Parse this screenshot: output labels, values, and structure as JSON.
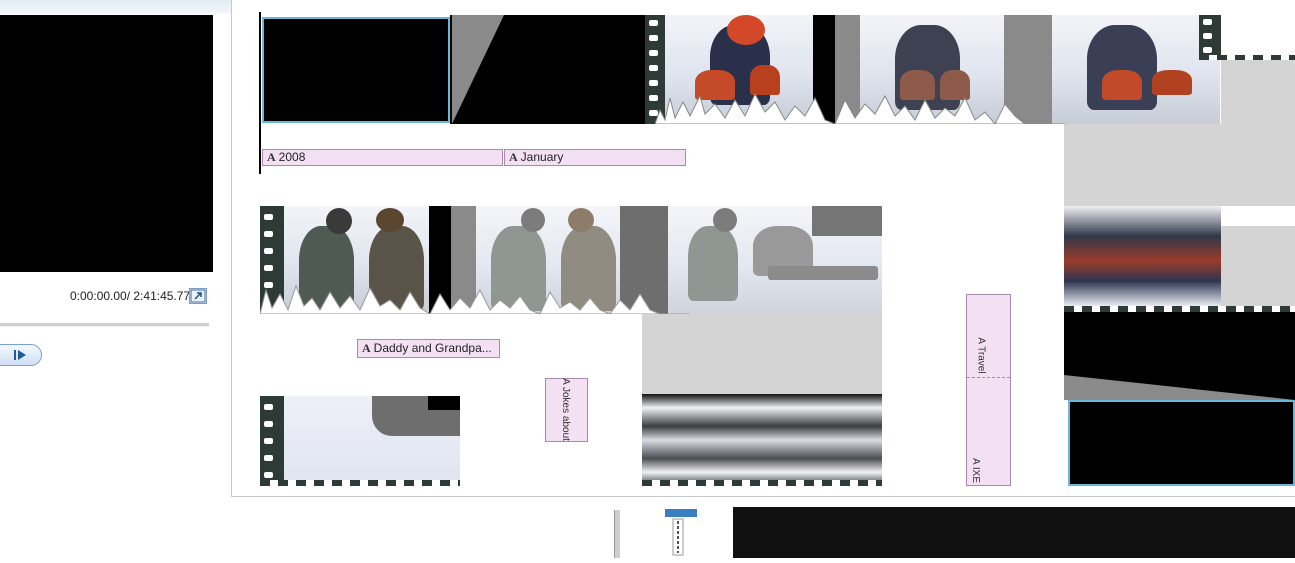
{
  "preview": {
    "timecode": "0:00:00.00/ 2:41:45.77"
  },
  "storyboard": {
    "captions": {
      "caption1": "2008",
      "caption2": "January",
      "caption3": "Daddy and Grandpa..."
    },
    "vertical_captions": {
      "v1": "A Jokes about",
      "v2": "A Travel",
      "v3": "A IXE"
    }
  },
  "colors": {
    "caption_fill": "#f3e1f3",
    "title_clip_border": "#6ab8d8",
    "filmstrip": "#2e3a36"
  }
}
